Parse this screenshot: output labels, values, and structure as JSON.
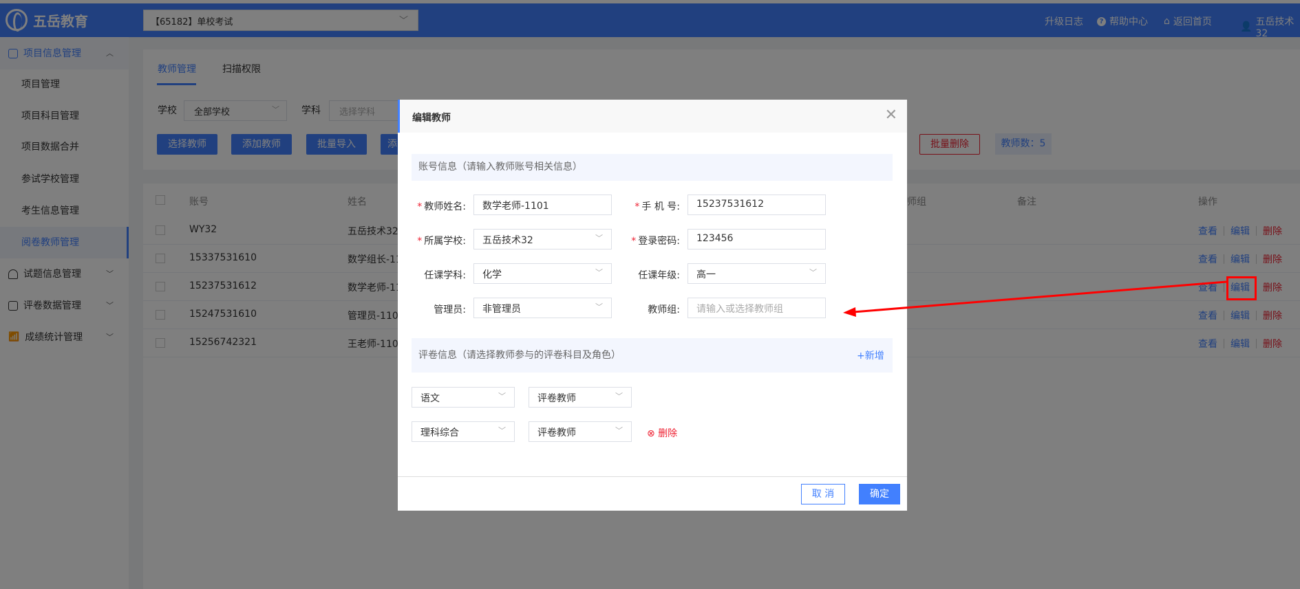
{
  "header": {
    "logo": "五岳教育",
    "project_select": "【65182】单校考试",
    "links": {
      "changelog": "升级日志",
      "help": "帮助中心",
      "home": "返回首页",
      "user": "五岳技术32"
    }
  },
  "sidebar": {
    "group1": "项目信息管理",
    "items": [
      "项目管理",
      "项目科目管理",
      "项目数据合并",
      "参试学校管理",
      "考生信息管理",
      "阅卷教师管理"
    ],
    "group2": "试题信息管理",
    "group3": "评卷数据管理",
    "group4": "成绩统计管理"
  },
  "tabs": [
    "教师管理",
    "扫描权限"
  ],
  "filters": {
    "school_label": "学校",
    "school_value": "全部学校",
    "subject_label": "学科",
    "subject_placeholder": "选择学科"
  },
  "buttons": {
    "select": "选择教师",
    "add": "添加教师",
    "import": "批量导入",
    "fourth": "添",
    "batch_delete": "批量删除",
    "count": "教师数：5"
  },
  "table": {
    "headers": {
      "account": "账号",
      "name": "姓名",
      "group": "师组",
      "note": "备注",
      "ops": "操作"
    },
    "rows": [
      {
        "account": "WY32",
        "name": "五岳技术32"
      },
      {
        "account": "15337531610",
        "name": "数学组长-11"
      },
      {
        "account": "15237531612",
        "name": "数学老师-11"
      },
      {
        "account": "15247531610",
        "name": "管理员-110"
      },
      {
        "account": "15256742321",
        "name": "王老师-110"
      }
    ],
    "ops": {
      "view": "查看",
      "edit": "编辑",
      "delete": "删除"
    }
  },
  "modal": {
    "title": "编辑教师",
    "section1": "账号信息（请输入教师账号相关信息）",
    "fields": {
      "name_label": "教师姓名:",
      "name": "数学老师-1101",
      "phone_label": "手 机 号:",
      "phone": "15237531612",
      "school_label": "所属学校:",
      "school": "五岳技术32",
      "password_label": "登录密码:",
      "password": "123456",
      "subject_label": "任课学科:",
      "subject": "化学",
      "grade_label": "任课年级:",
      "grade": "高一",
      "admin_label": "管理员:",
      "admin": "非管理员",
      "group_label": "教师组:",
      "group_placeholder": "请输入或选择教师组"
    },
    "section2": "评卷信息（请选择教师参与的评卷科目及角色）",
    "add": "+新增",
    "grading": [
      {
        "subject": "语文",
        "role": "评卷教师"
      },
      {
        "subject": "理科综合",
        "role": "评卷教师"
      }
    ],
    "delete": "删除",
    "cancel": "取 消",
    "confirm": "确定"
  },
  "colors": {
    "accent": "#4280fe",
    "danger": "#ee2233",
    "annotation": "#ff0000"
  }
}
